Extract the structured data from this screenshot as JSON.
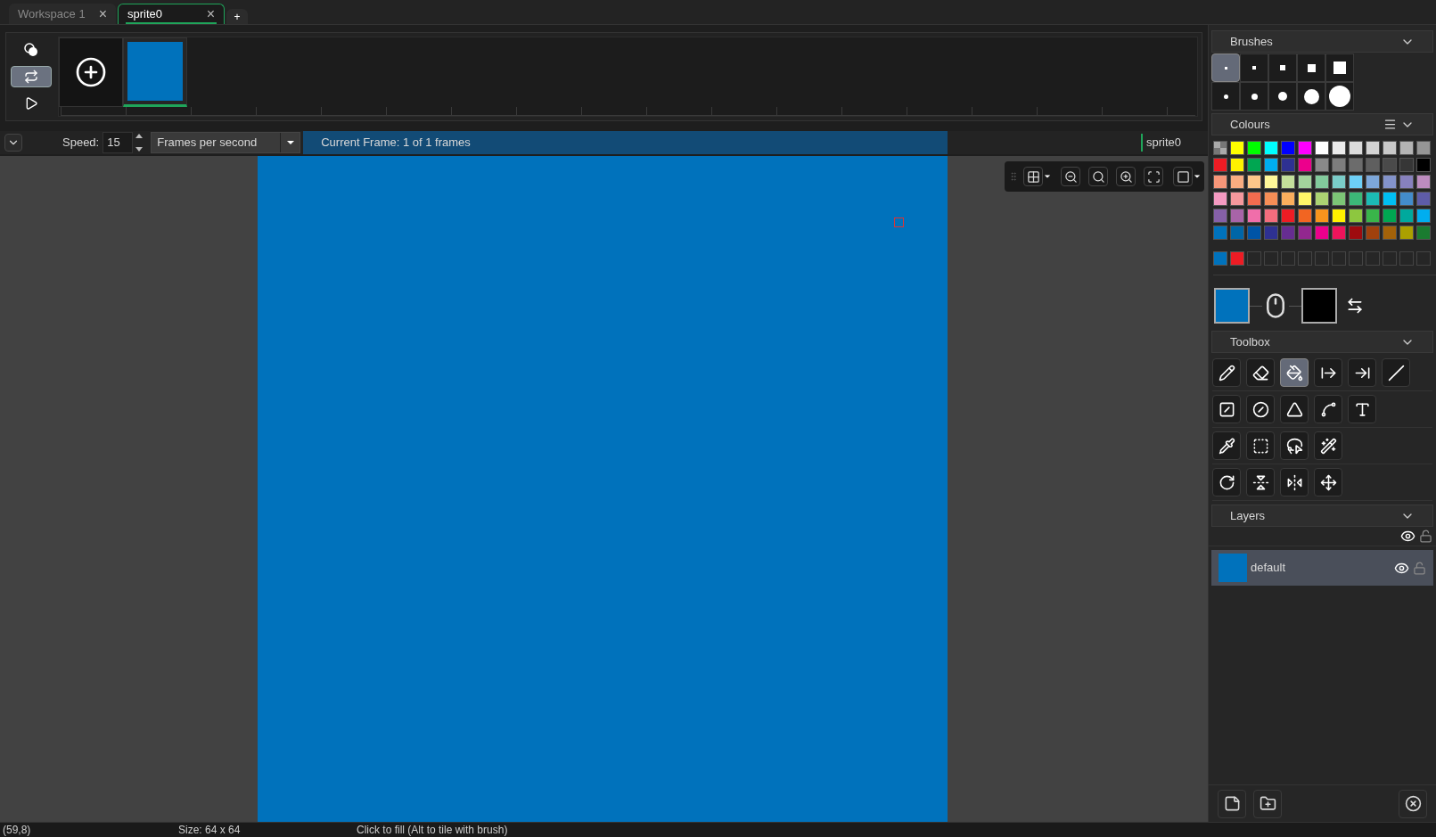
{
  "tabs": [
    {
      "label": "Workspace 1",
      "selected": false,
      "close": "×"
    },
    {
      "label": "sprite0",
      "selected": true,
      "close": "×"
    }
  ],
  "new_tab": "+",
  "timeline": {
    "loop_on": true,
    "frames": [
      {
        "color": "#0072bc",
        "selected": true
      }
    ]
  },
  "frame_bar": {
    "speed_label": "Speed:",
    "speed_value": "15",
    "speed_unit": "Frames per second",
    "current_frame": "Current Frame: 1 of 1 frames",
    "sprite_name": "sprite0"
  },
  "canvas": {
    "color": "#0072bc"
  },
  "brushes": {
    "title": "Brushes",
    "items": [
      {
        "kind": "square",
        "selected": true
      },
      {
        "kind": "square",
        "selected": false
      },
      {
        "kind": "square",
        "selected": false
      },
      {
        "kind": "square",
        "selected": false
      },
      {
        "kind": "square",
        "selected": false
      },
      {
        "kind": "circle",
        "selected": false
      },
      {
        "kind": "circle",
        "selected": false
      },
      {
        "kind": "circle",
        "selected": false
      },
      {
        "kind": "circle",
        "selected": false
      },
      {
        "kind": "circle",
        "selected": false
      }
    ]
  },
  "colours": {
    "title": "Colours",
    "palette": [
      {
        "kind": "transparent"
      },
      {
        "color": "#ffff00"
      },
      {
        "color": "#00ff00"
      },
      {
        "color": "#00ffff"
      },
      {
        "color": "#0000ff"
      },
      {
        "color": "#ff00ff"
      },
      {
        "color": "#ffffff"
      },
      {
        "color": "#ebebeb"
      },
      {
        "color": "#dcdcdc"
      },
      {
        "color": "#d4d4d4"
      },
      {
        "color": "#c8c8c8"
      },
      {
        "color": "#b4b4b4"
      },
      {
        "color": "#969696"
      },
      {
        "color": "#ed1c24"
      },
      {
        "color": "#fff200"
      },
      {
        "color": "#00a651"
      },
      {
        "color": "#00aeef"
      },
      {
        "color": "#2e3192"
      },
      {
        "color": "#ec008c"
      },
      {
        "color": "#898989"
      },
      {
        "color": "#7d7d7d"
      },
      {
        "color": "#6c6c6c"
      },
      {
        "color": "#5f5f5f"
      },
      {
        "color": "#4a4a4a"
      },
      {
        "color": "#363636"
      },
      {
        "color": "#000000"
      },
      {
        "color": "#f69679"
      },
      {
        "color": "#f9ad81"
      },
      {
        "color": "#fdc689"
      },
      {
        "color": "#fff799"
      },
      {
        "color": "#c4df9b"
      },
      {
        "color": "#a3d39c"
      },
      {
        "color": "#82ca9c"
      },
      {
        "color": "#7accc8"
      },
      {
        "color": "#6dcff6"
      },
      {
        "color": "#7da7d9"
      },
      {
        "color": "#8393ca"
      },
      {
        "color": "#8781bd"
      },
      {
        "color": "#bd8cbf"
      },
      {
        "color": "#f49ac1"
      },
      {
        "color": "#f5989d"
      },
      {
        "color": "#f26c4f"
      },
      {
        "color": "#f68e56"
      },
      {
        "color": "#fbaf5d"
      },
      {
        "color": "#fff568"
      },
      {
        "color": "#acd372"
      },
      {
        "color": "#7cc576"
      },
      {
        "color": "#3cb878"
      },
      {
        "color": "#1cbbb4"
      },
      {
        "color": "#00bff3"
      },
      {
        "color": "#438ccb"
      },
      {
        "color": "#5e5ca8"
      },
      {
        "color": "#8560a8"
      },
      {
        "color": "#a864a8"
      },
      {
        "color": "#f06eaa"
      },
      {
        "color": "#f26d7d"
      },
      {
        "color": "#ed1c24"
      },
      {
        "color": "#f26522"
      },
      {
        "color": "#f7941d"
      },
      {
        "color": "#fff200"
      },
      {
        "color": "#8dc73f"
      },
      {
        "color": "#39b54a"
      },
      {
        "color": "#00a651"
      },
      {
        "color": "#00a99d"
      },
      {
        "color": "#00aeef"
      },
      {
        "color": "#0072bc"
      },
      {
        "color": "#0066a8"
      },
      {
        "color": "#0054a6"
      },
      {
        "color": "#2e3192"
      },
      {
        "color": "#662d91"
      },
      {
        "color": "#92278f"
      },
      {
        "color": "#ec008c"
      },
      {
        "color": "#ed145b"
      },
      {
        "color": "#9e0b0f"
      },
      {
        "color": "#a0410d"
      },
      {
        "color": "#a36209"
      },
      {
        "color": "#aba000"
      },
      {
        "color": "#1a7b30"
      }
    ],
    "custom": [
      {
        "color": "#0072bc"
      },
      {
        "color": "#ed1c24"
      },
      {
        "kind": "empty"
      },
      {
        "kind": "empty"
      },
      {
        "kind": "empty"
      },
      {
        "kind": "empty"
      },
      {
        "kind": "empty"
      },
      {
        "kind": "empty"
      },
      {
        "kind": "empty"
      },
      {
        "kind": "empty"
      },
      {
        "kind": "empty"
      },
      {
        "kind": "empty"
      },
      {
        "kind": "empty"
      }
    ],
    "primary": {
      "color": "#0072bc"
    },
    "secondary": {
      "color": "#000000"
    }
  },
  "toolbox": {
    "title": "Toolbox",
    "rows": [
      [
        {
          "selected": false
        },
        {
          "selected": false
        },
        {
          "selected": true
        },
        {
          "selected": false
        },
        {
          "selected": false
        },
        {
          "selected": false
        }
      ],
      [
        {
          "selected": false
        },
        {
          "selected": false
        },
        {
          "selected": false
        },
        {
          "selected": false
        },
        {
          "selected": false
        }
      ],
      [
        {
          "selected": false
        },
        {
          "selected": false
        },
        {
          "selected": false
        },
        {
          "selected": false
        }
      ],
      [
        {
          "selected": false
        },
        {
          "selected": false
        },
        {
          "selected": false
        },
        {
          "selected": false
        }
      ]
    ]
  },
  "layers": {
    "title": "Layers",
    "all_visible": true,
    "all_locked": false,
    "items": [
      {
        "name": "default",
        "color": "#0072bc",
        "selected": true,
        "visible": true,
        "locked": false
      }
    ]
  },
  "status_bar": {
    "position": "(59,8)",
    "size": "Size: 64 x 64",
    "hint": "Click to fill (Alt to tile with brush)"
  }
}
